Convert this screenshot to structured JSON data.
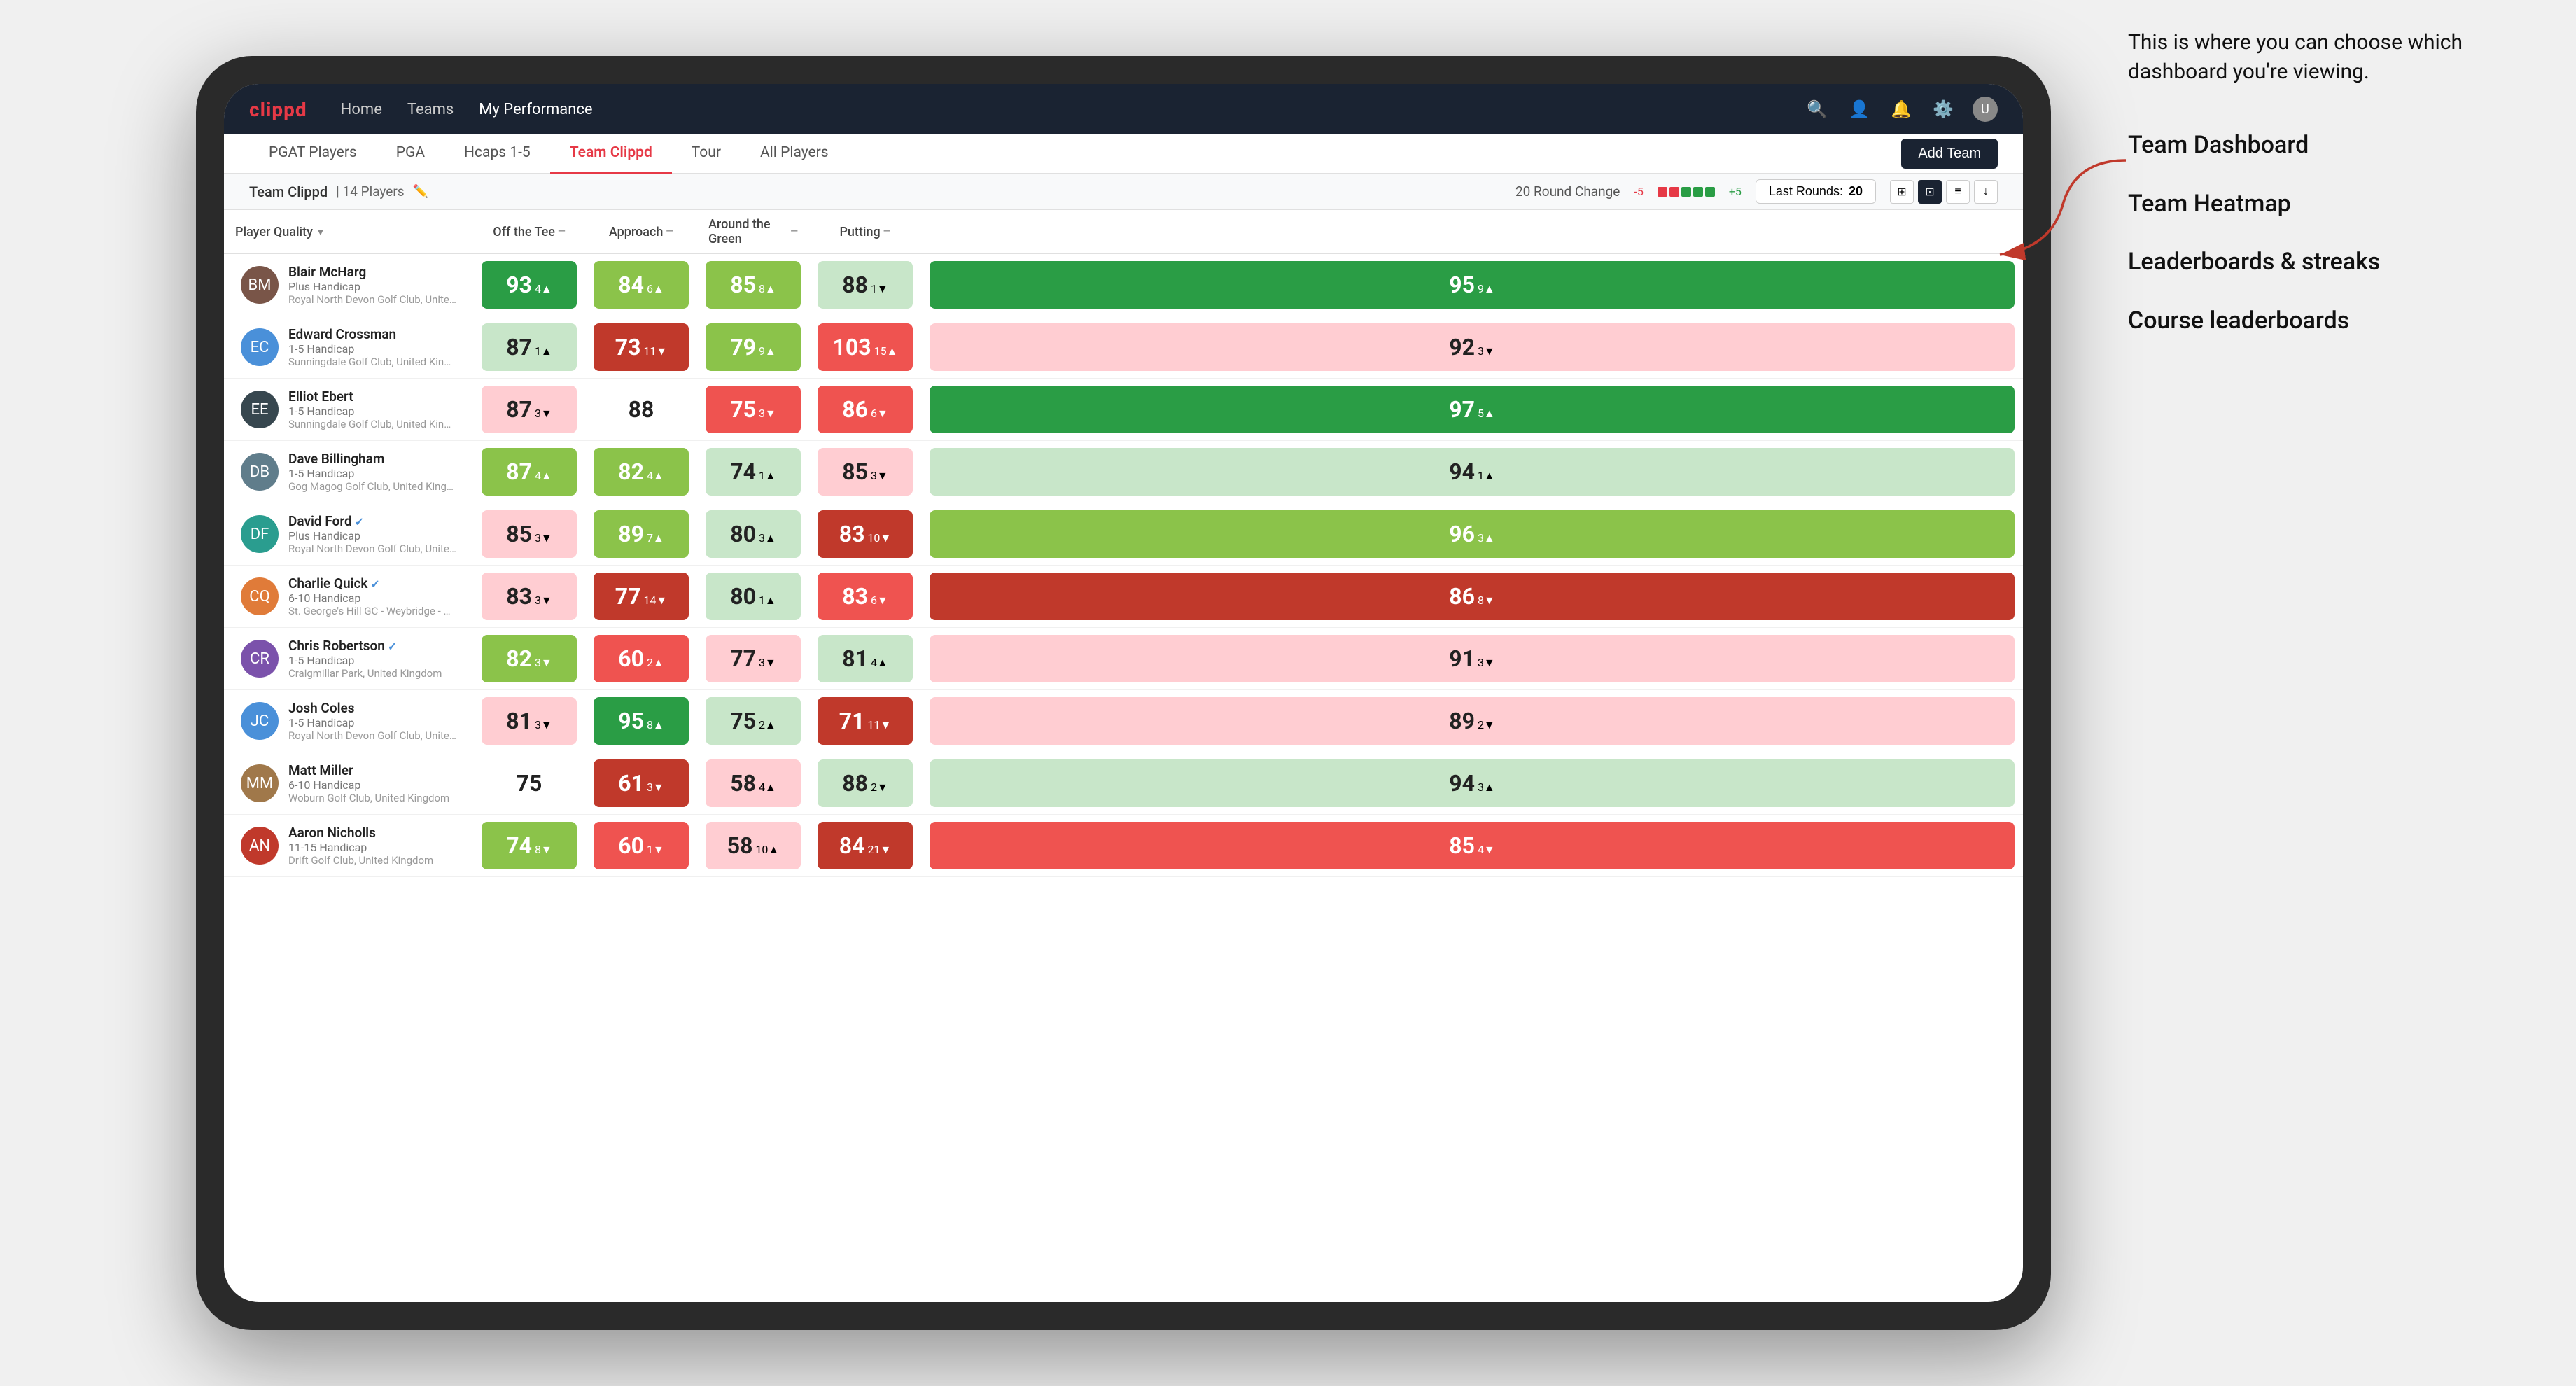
{
  "annotation": {
    "intro": "This is where you can choose which dashboard you're viewing.",
    "items": [
      "Team Dashboard",
      "Team Heatmap",
      "Leaderboards & streaks",
      "Course leaderboards"
    ]
  },
  "nav": {
    "logo": "clippd",
    "links": [
      {
        "label": "Home",
        "active": false
      },
      {
        "label": "Teams",
        "active": false
      },
      {
        "label": "My Performance",
        "active": true
      }
    ],
    "icons": [
      "search",
      "person",
      "bell",
      "settings",
      "avatar"
    ]
  },
  "sub_nav": {
    "links": [
      {
        "label": "PGAT Players",
        "active": false
      },
      {
        "label": "PGA",
        "active": false
      },
      {
        "label": "Hcaps 1-5",
        "active": false
      },
      {
        "label": "Team Clippd",
        "active": true
      },
      {
        "label": "Tour",
        "active": false
      },
      {
        "label": "All Players",
        "active": false
      }
    ],
    "add_team_label": "Add Team"
  },
  "team_bar": {
    "name": "Team Clippd",
    "separator": "|",
    "count": "14 Players",
    "round_change_label": "20 Round Change",
    "change_neg": "-5",
    "change_pos": "+5",
    "last_rounds_label": "Last Rounds:",
    "last_rounds_value": "20",
    "view_icons": [
      "grid-small",
      "grid-large",
      "heatmap",
      "download"
    ]
  },
  "table": {
    "headers": [
      {
        "label": "Player Quality",
        "key": "player_quality",
        "sortable": true
      },
      {
        "label": "Off the Tee",
        "key": "off_tee",
        "sortable": true
      },
      {
        "label": "Approach",
        "key": "approach",
        "sortable": true
      },
      {
        "label": "Around the Green",
        "key": "around_green",
        "sortable": true
      },
      {
        "label": "Putting",
        "key": "putting",
        "sortable": true
      }
    ],
    "rows": [
      {
        "name": "Blair McHarg",
        "handicap": "Plus Handicap",
        "club": "Royal North Devon Golf Club, United Kingdom",
        "avatar_color": "av-brown",
        "player_quality": {
          "value": 93,
          "change": "+4",
          "dir": "up",
          "color": "cell-green-dark"
        },
        "off_tee": {
          "value": 84,
          "change": "+6",
          "dir": "up",
          "color": "cell-green-light"
        },
        "approach": {
          "value": 85,
          "change": "+8",
          "dir": "up",
          "color": "cell-green-light"
        },
        "around_green": {
          "value": 88,
          "change": "-1",
          "dir": "down",
          "color": "cell-green-pale"
        },
        "putting": {
          "value": 95,
          "change": "+9",
          "dir": "up",
          "color": "cell-green-dark"
        }
      },
      {
        "name": "Edward Crossman",
        "handicap": "1-5 Handicap",
        "club": "Sunningdale Golf Club, United Kingdom",
        "avatar_color": "av-blue",
        "player_quality": {
          "value": 87,
          "change": "+1",
          "dir": "up",
          "color": "cell-green-pale"
        },
        "off_tee": {
          "value": 73,
          "change": "-11",
          "dir": "down",
          "color": "cell-red-dark"
        },
        "approach": {
          "value": 79,
          "change": "+9",
          "dir": "up",
          "color": "cell-green-light"
        },
        "around_green": {
          "value": 103,
          "change": "+15",
          "dir": "up",
          "color": "cell-red-light"
        },
        "putting": {
          "value": 92,
          "change": "-3",
          "dir": "down",
          "color": "cell-red-pale"
        }
      },
      {
        "name": "Elliot Ebert",
        "handicap": "1-5 Handicap",
        "club": "Sunningdale Golf Club, United Kingdom",
        "avatar_color": "av-dark",
        "player_quality": {
          "value": 87,
          "change": "-3",
          "dir": "down",
          "color": "cell-red-pale"
        },
        "off_tee": {
          "value": 88,
          "change": "",
          "dir": "",
          "color": "cell-white"
        },
        "approach": {
          "value": 75,
          "change": "-3",
          "dir": "down",
          "color": "cell-red-light"
        },
        "around_green": {
          "value": 86,
          "change": "-6",
          "dir": "down",
          "color": "cell-red-light"
        },
        "putting": {
          "value": 97,
          "change": "+5",
          "dir": "up",
          "color": "cell-green-dark"
        }
      },
      {
        "name": "Dave Billingham",
        "handicap": "1-5 Handicap",
        "club": "Gog Magog Golf Club, United Kingdom",
        "avatar_color": "av-grey",
        "player_quality": {
          "value": 87,
          "change": "+4",
          "dir": "up",
          "color": "cell-green-light"
        },
        "off_tee": {
          "value": 82,
          "change": "+4",
          "dir": "up",
          "color": "cell-green-light"
        },
        "approach": {
          "value": 74,
          "change": "+1",
          "dir": "up",
          "color": "cell-green-pale"
        },
        "around_green": {
          "value": 85,
          "change": "-3",
          "dir": "down",
          "color": "cell-red-pale"
        },
        "putting": {
          "value": 94,
          "change": "+1",
          "dir": "up",
          "color": "cell-green-pale"
        }
      },
      {
        "name": "David Ford",
        "handicap": "Plus Handicap",
        "club": "Royal North Devon Golf Club, United Kingdom",
        "avatar_color": "av-teal",
        "verified": true,
        "player_quality": {
          "value": 85,
          "change": "-3",
          "dir": "down",
          "color": "cell-red-pale"
        },
        "off_tee": {
          "value": 89,
          "change": "+7",
          "dir": "up",
          "color": "cell-green-light"
        },
        "approach": {
          "value": 80,
          "change": "+3",
          "dir": "up",
          "color": "cell-green-pale"
        },
        "around_green": {
          "value": 83,
          "change": "-10",
          "dir": "down",
          "color": "cell-red-dark"
        },
        "putting": {
          "value": 96,
          "change": "+3",
          "dir": "up",
          "color": "cell-green-light"
        }
      },
      {
        "name": "Charlie Quick",
        "handicap": "6-10 Handicap",
        "club": "St. George's Hill GC - Weybridge - Surrey, Uni...",
        "avatar_color": "av-orange",
        "verified": true,
        "player_quality": {
          "value": 83,
          "change": "-3",
          "dir": "down",
          "color": "cell-red-pale"
        },
        "off_tee": {
          "value": 77,
          "change": "-14",
          "dir": "down",
          "color": "cell-red-dark"
        },
        "approach": {
          "value": 80,
          "change": "+1",
          "dir": "up",
          "color": "cell-green-pale"
        },
        "around_green": {
          "value": 83,
          "change": "-6",
          "dir": "down",
          "color": "cell-red-light"
        },
        "putting": {
          "value": 86,
          "change": "-8",
          "dir": "down",
          "color": "cell-red-dark"
        }
      },
      {
        "name": "Chris Robertson",
        "handicap": "1-5 Handicap",
        "club": "Craigmillar Park, United Kingdom",
        "avatar_color": "av-purple",
        "verified": true,
        "player_quality": {
          "value": 82,
          "change": "-3",
          "dir": "down",
          "color": "cell-green-light"
        },
        "off_tee": {
          "value": 60,
          "change": "+2",
          "dir": "up",
          "color": "cell-red-light"
        },
        "approach": {
          "value": 77,
          "change": "-3",
          "dir": "down",
          "color": "cell-red-pale"
        },
        "around_green": {
          "value": 81,
          "change": "+4",
          "dir": "up",
          "color": "cell-green-pale"
        },
        "putting": {
          "value": 91,
          "change": "-3",
          "dir": "down",
          "color": "cell-red-pale"
        }
      },
      {
        "name": "Josh Coles",
        "handicap": "1-5 Handicap",
        "club": "Royal North Devon Golf Club, United Kingdom",
        "avatar_color": "av-blue",
        "player_quality": {
          "value": 81,
          "change": "-3",
          "dir": "down",
          "color": "cell-red-pale"
        },
        "off_tee": {
          "value": 95,
          "change": "+8",
          "dir": "up",
          "color": "cell-green-dark"
        },
        "approach": {
          "value": 75,
          "change": "+2",
          "dir": "up",
          "color": "cell-green-pale"
        },
        "around_green": {
          "value": 71,
          "change": "-11",
          "dir": "down",
          "color": "cell-red-dark"
        },
        "putting": {
          "value": 89,
          "change": "-2",
          "dir": "down",
          "color": "cell-red-pale"
        }
      },
      {
        "name": "Matt Miller",
        "handicap": "6-10 Handicap",
        "club": "Woburn Golf Club, United Kingdom",
        "avatar_color": "av-tan",
        "player_quality": {
          "value": 75,
          "change": "",
          "dir": "",
          "color": "cell-white"
        },
        "off_tee": {
          "value": 61,
          "change": "-3",
          "dir": "down",
          "color": "cell-red-dark"
        },
        "approach": {
          "value": 58,
          "change": "+4",
          "dir": "up",
          "color": "cell-red-pale"
        },
        "around_green": {
          "value": 88,
          "change": "-2",
          "dir": "down",
          "color": "cell-green-pale"
        },
        "putting": {
          "value": 94,
          "change": "+3",
          "dir": "up",
          "color": "cell-green-pale"
        }
      },
      {
        "name": "Aaron Nicholls",
        "handicap": "11-15 Handicap",
        "club": "Drift Golf Club, United Kingdom",
        "avatar_color": "av-red",
        "player_quality": {
          "value": 74,
          "change": "-8",
          "dir": "down",
          "color": "cell-green-light"
        },
        "off_tee": {
          "value": 60,
          "change": "-1",
          "dir": "down",
          "color": "cell-red-light"
        },
        "approach": {
          "value": 58,
          "change": "+10",
          "dir": "up",
          "color": "cell-red-pale"
        },
        "around_green": {
          "value": 84,
          "change": "-21",
          "dir": "down",
          "color": "cell-red-dark"
        },
        "putting": {
          "value": 85,
          "change": "-4",
          "dir": "down",
          "color": "cell-red-light"
        }
      }
    ]
  }
}
